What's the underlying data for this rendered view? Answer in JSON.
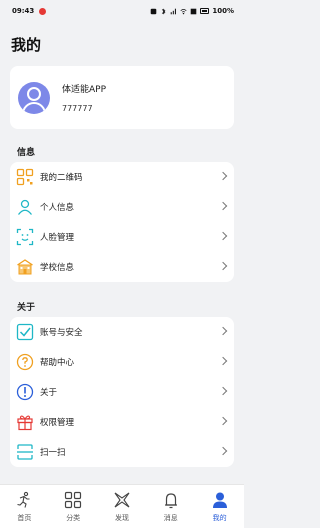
{
  "status_bar": {
    "time": "09:43",
    "battery": "100%"
  },
  "page": {
    "title": "我的"
  },
  "profile": {
    "name": "体适能APP",
    "user_id": "777777"
  },
  "sections": {
    "info": {
      "title": "信息",
      "items": [
        {
          "label": "我的二维码",
          "icon": "qr-code-icon"
        },
        {
          "label": "个人信息",
          "icon": "person-icon"
        },
        {
          "label": "人脸管理",
          "icon": "face-scan-icon"
        },
        {
          "label": "学校信息",
          "icon": "school-icon"
        }
      ]
    },
    "about": {
      "title": "关于",
      "items": [
        {
          "label": "账号与安全",
          "icon": "shield-check-icon"
        },
        {
          "label": "帮助中心",
          "icon": "help-icon"
        },
        {
          "label": "关于",
          "icon": "info-icon"
        },
        {
          "label": "权限管理",
          "icon": "gift-icon"
        },
        {
          "label": "扫一扫",
          "icon": "scan-icon"
        }
      ]
    }
  },
  "bottom_nav": {
    "items": [
      {
        "label": "首页",
        "icon": "home-runner-icon"
      },
      {
        "label": "分类",
        "icon": "grid-icon"
      },
      {
        "label": "发现",
        "icon": "discover-icon"
      },
      {
        "label": "消息",
        "icon": "bell-icon"
      },
      {
        "label": "我的",
        "icon": "profile-icon",
        "active": true
      }
    ]
  },
  "colors": {
    "accent": "#2b5fd9",
    "icon_orange": "#f0a020",
    "icon_cyan": "#1eb7c6",
    "avatar": "#7d88e8"
  }
}
